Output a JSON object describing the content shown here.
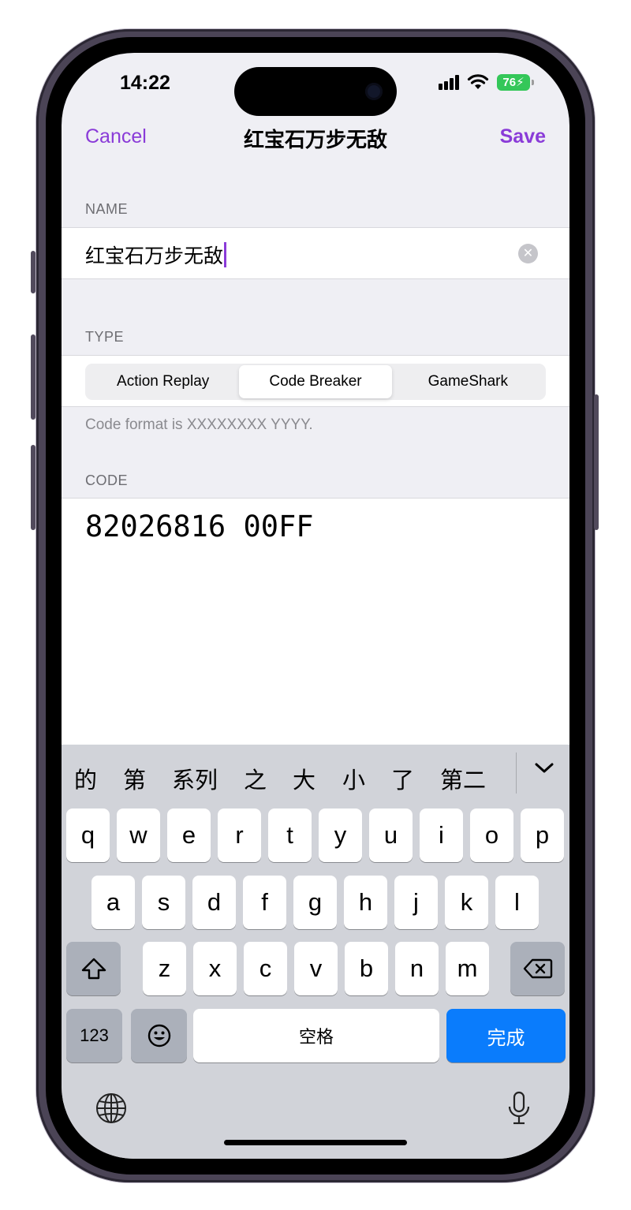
{
  "status_bar": {
    "time": "14:22",
    "battery": "76"
  },
  "nav": {
    "cancel": "Cancel",
    "title": "红宝石万步无敌",
    "save": "Save"
  },
  "name_section": {
    "label": "NAME",
    "value": "红宝石万步无敌"
  },
  "type_section": {
    "label": "TYPE",
    "options": [
      "Action Replay",
      "Code Breaker",
      "GameShark"
    ],
    "selected": "Code Breaker",
    "footer": "Code format is XXXXXXXX YYYY."
  },
  "code_section": {
    "label": "CODE",
    "value": "82026816 00FF"
  },
  "keyboard": {
    "candidates": [
      "的",
      "第",
      "系列",
      "之",
      "大",
      "小",
      "了",
      "第二"
    ],
    "rows": [
      [
        "q",
        "w",
        "e",
        "r",
        "t",
        "y",
        "u",
        "i",
        "o",
        "p"
      ],
      [
        "a",
        "s",
        "d",
        "f",
        "g",
        "h",
        "j",
        "k",
        "l"
      ],
      [
        "z",
        "x",
        "c",
        "v",
        "b",
        "n",
        "m"
      ]
    ],
    "numbers_key": "123",
    "space_key": "空格",
    "done_key": "完成"
  },
  "colors": {
    "accent": "#8a3bd8",
    "done_key": "#0a7cfc",
    "battery": "#34c759"
  },
  "icons": [
    "wifi-icon",
    "clear-text-icon",
    "chevron-down-icon",
    "shift-icon",
    "delete-icon",
    "emoji-icon",
    "globe-icon",
    "microphone-icon"
  ]
}
